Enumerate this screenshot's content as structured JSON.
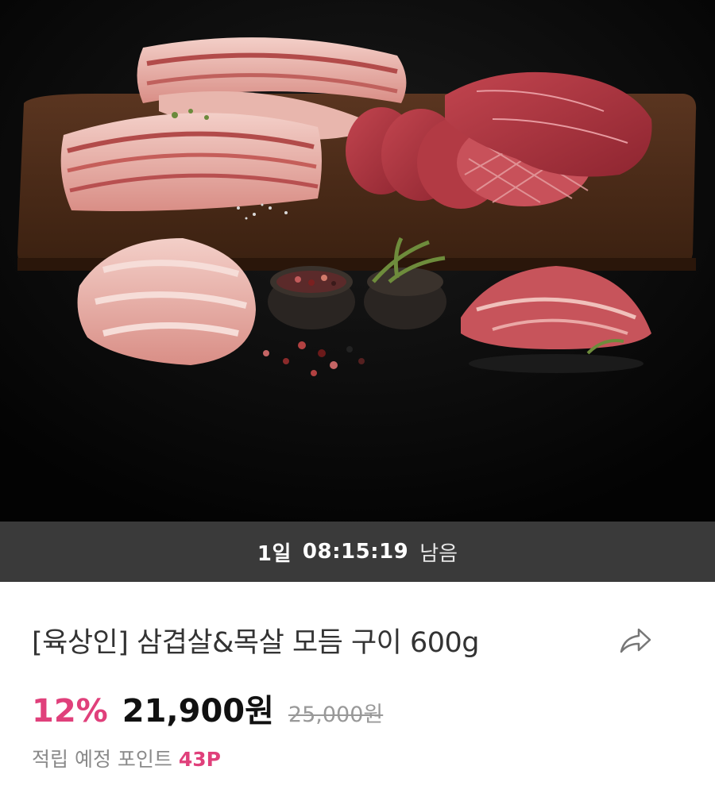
{
  "hero": {
    "image": "meat-assortment-photo",
    "colors": {
      "background": "#060606",
      "board": "#4a2a17"
    }
  },
  "timer": {
    "days": "1일",
    "time": "08:15:19",
    "suffix": "남음"
  },
  "product": {
    "title": "[육상인] 삼겹살&목살 모듬 구이 600g",
    "share_icon": "share-arrow-icon"
  },
  "price": {
    "discount": "12%",
    "sale": "21,900원",
    "original": "25,000원"
  },
  "points": {
    "label": "적립 예정 포인트",
    "value": "43P"
  },
  "colors": {
    "accent": "#e0407b",
    "timer_bg": "#3a3a3a"
  }
}
